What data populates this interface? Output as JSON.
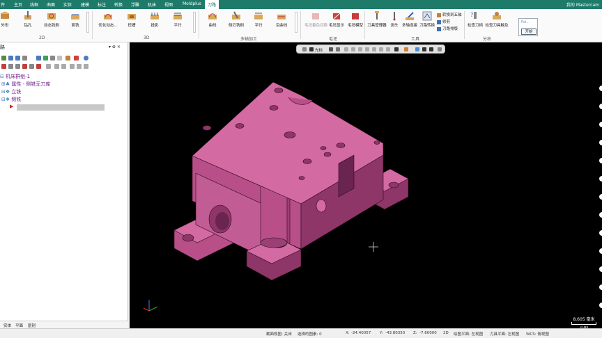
{
  "menubar": {
    "items": [
      "件",
      "主页",
      "线框",
      "曲面",
      "实体",
      "建模",
      "标注",
      "转换",
      "浮雕",
      "机床",
      "视图",
      "Moldplus",
      "刀路"
    ],
    "active_index": 12,
    "user": "我的 Mastercam"
  },
  "ribbon": {
    "group_2d": {
      "label": "2D",
      "buttons": [
        "外形",
        "钻孔",
        "动态铣削",
        "面铣"
      ]
    },
    "group_3d": {
      "label": "3D",
      "buttons": [
        "优化动态...",
        "挖槽",
        "投影",
        "平行"
      ]
    },
    "group_multiaxis": {
      "label": "多轴加工",
      "buttons": [
        "曲线",
        "侧刃铣削",
        "平行",
        "沿曲线"
      ]
    },
    "group_stock": {
      "label": "毛坯",
      "buttons": [
        "毛坯着色切换",
        "毛坯显示",
        "毛坯模型"
      ]
    },
    "group_tools": {
      "label": "工具",
      "buttons": [
        "刀具管理器",
        "测头",
        "多轴连接",
        "刀路转换"
      ],
      "small_buttons": [
        "转换到五轴",
        "修剪",
        "刀路排版"
      ]
    },
    "group_analysis": {
      "label": "分析",
      "buttons": [
        "检查刀柄",
        "检查刀具触及"
      ]
    },
    "popup": {
      "field": "Poi...",
      "start_label": "开始"
    }
  },
  "left_panel": {
    "title_char": "路",
    "pin": "▾ ⊕ ×",
    "tree": [
      {
        "label": "机床群组-1",
        "indent": 0
      },
      {
        "label": "属性 - 侧铣无刀库",
        "indent": 1
      },
      {
        "label": "立铣",
        "indent": 1
      },
      {
        "label": "侧铣",
        "indent": 1
      }
    ]
  },
  "viewbar": {
    "label": "光标"
  },
  "bottom_tabs": [
    "实体",
    "平面",
    "层别"
  ],
  "status": {
    "section_view": "截面视图: 关闭",
    "selected": "选择的图素: 0",
    "x_label": "X:",
    "x_value": "-24.40057",
    "y_label": "Y:",
    "y_value": "-43.80350",
    "z_label": "Z:",
    "z_value": "-7.60000",
    "mode": "2D",
    "gview": "绘图平面: 左视图",
    "tplane": "刀具平面: 左视图",
    "wcs": "WCS: 俯视图"
  },
  "scale": {
    "value": "8.605 毫米",
    "unit": "公制"
  },
  "colors": {
    "menubar": "#1e7b6a",
    "part_top": "#d46aa2",
    "part_side_light": "#b84f88",
    "part_side_dark": "#8e3668",
    "viewport_bg": "#000000"
  }
}
